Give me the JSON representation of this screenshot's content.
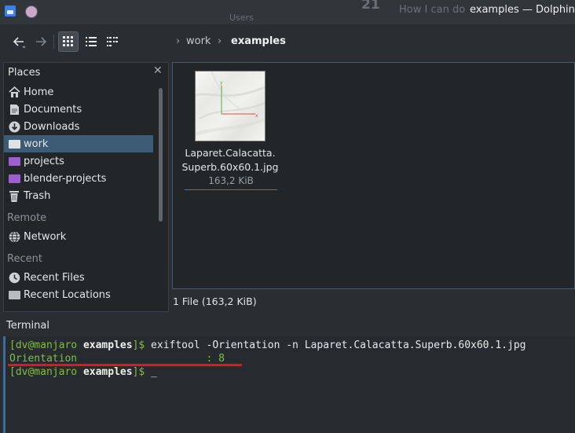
{
  "window": {
    "title": "examples — Dolphin",
    "background_text": {
      "users": "Users",
      "vote_count": "21",
      "question": "How I can do"
    }
  },
  "breadcrumb": {
    "parent": "work",
    "current": "examples"
  },
  "places": {
    "header": "Places",
    "items": [
      {
        "label": "Home",
        "icon": "home-icon"
      },
      {
        "label": "Documents",
        "icon": "documents-icon"
      },
      {
        "label": "Downloads",
        "icon": "downloads-icon"
      },
      {
        "label": "work",
        "icon": "folder-icon",
        "selected": true
      },
      {
        "label": "projects",
        "icon": "purple-folder-icon"
      },
      {
        "label": "blender-projects",
        "icon": "purple-folder-icon"
      },
      {
        "label": "Trash",
        "icon": "trash-icon"
      }
    ],
    "remote_header": "Remote",
    "remote_items": [
      {
        "label": "Network",
        "icon": "network-icon"
      }
    ],
    "recent_header": "Recent",
    "recent_items": [
      {
        "label": "Recent Files",
        "icon": "recent-files-icon"
      },
      {
        "label": "Recent Locations",
        "icon": "recent-locations-icon"
      }
    ]
  },
  "file": {
    "name_line1": "Laparet.Calacatta.",
    "name_line2": "Superb.60x60.1.jpg",
    "size": "163,2 KiB",
    "thumb_axis_y": "y",
    "thumb_axis_x": "x"
  },
  "status": "1 File (163,2 KiB)",
  "terminal": {
    "label": "Terminal",
    "prompt_open": "[",
    "user_host": "dv@manjaro",
    "cwd": "examples",
    "prompt_close": "]$",
    "command": "exiftool -Orientation -n Laparet.Calacatta.Superb.60x60.1.jpg",
    "output": "Orientation                     : 8",
    "cursor": "_"
  },
  "colors": {
    "accent": "#3b5c74",
    "terminal_green": "#7fbf3f",
    "highlight_red": "#e0171f"
  }
}
